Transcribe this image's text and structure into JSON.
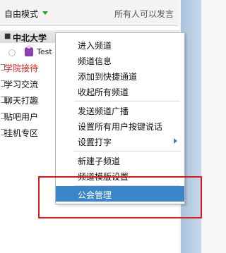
{
  "modebar": {
    "mode_label": "自由模式",
    "right_label": "所有人可以发言"
  },
  "tree": {
    "root_label": "中北大学",
    "user_label": "Test",
    "subchannels": [
      {
        "label": "学院接待",
        "color": "#e02020"
      },
      {
        "label": "学习交流",
        "color": "#111111"
      },
      {
        "label": "聊天打趣",
        "color": "#111111"
      },
      {
        "label": "贴吧用户",
        "color": "#111111"
      },
      {
        "label": "挂机专区",
        "color": "#111111"
      }
    ]
  },
  "context_menu": {
    "items": [
      {
        "label": "进入频道"
      },
      {
        "label": "频道信息"
      },
      {
        "label": "添加到快捷通道"
      },
      {
        "label": "收起所有频道"
      },
      {
        "label": "发送频道广播"
      },
      {
        "label": "设置所有用户按键说话"
      },
      {
        "label": "设置打字",
        "has_submenu": true
      },
      {
        "label": "新建子频道"
      },
      {
        "label": "频道模版设置"
      },
      {
        "label": "公会管理",
        "highlighted": true
      }
    ]
  },
  "colors": {
    "highlight": "#3b86c8",
    "annotation_box": "#e01818",
    "accent_caret": "#2b9a2b"
  }
}
